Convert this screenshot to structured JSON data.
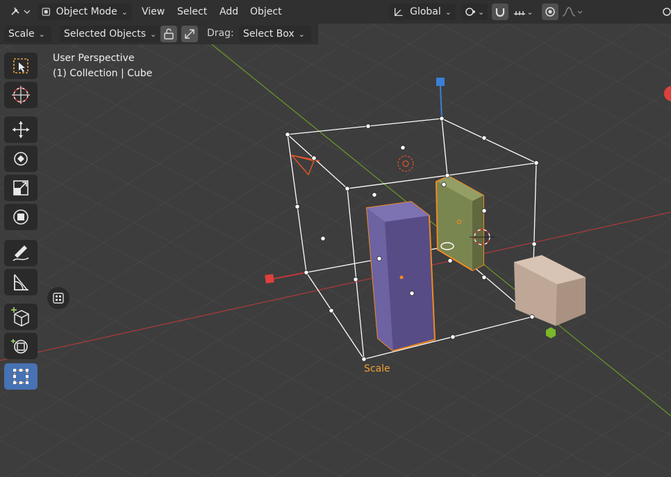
{
  "header": {
    "mode_label": "Object Mode",
    "menus": [
      "View",
      "Select",
      "Add",
      "Object"
    ],
    "orientation_label": "Global"
  },
  "tool_settings": {
    "tool_label": "Scale",
    "affect_label": "Selected Objects",
    "drag_label": "Drag:",
    "drag_value": "Select Box"
  },
  "overlay": {
    "view_name": "User Perspective",
    "collection_info": "(1) Collection | Cube"
  },
  "operator_label": "Scale",
  "toolbar": {
    "tools": [
      {
        "name": "select-box",
        "icon": "select-box-icon",
        "active": false
      },
      {
        "name": "cursor",
        "icon": "cursor-icon",
        "active": false
      },
      {
        "name": "move",
        "icon": "move-icon",
        "active": false
      },
      {
        "name": "rotate",
        "icon": "rotate-icon",
        "active": false
      },
      {
        "name": "scale",
        "icon": "scale-icon",
        "active": false
      },
      {
        "name": "transform",
        "icon": "transform-icon",
        "active": false
      },
      {
        "name": "annotate",
        "icon": "annotate-icon",
        "active": false
      },
      {
        "name": "measure",
        "icon": "measure-icon",
        "active": false
      },
      {
        "name": "add-cube",
        "icon": "add-cube-icon",
        "active": false
      },
      {
        "name": "spin",
        "icon": "spin-icon",
        "active": false
      },
      {
        "name": "scale-cage",
        "icon": "scale-cage-icon",
        "active": true
      }
    ]
  },
  "colors": {
    "header_bg": "#303030",
    "viewport_bg": "#3d3d3d",
    "active_tool": "#4772b3",
    "selection_orange": "#f08a24",
    "axis_x": "#c0373a",
    "axis_y": "#6a9a2a",
    "axis_z": "#3a7fd8",
    "purple_box": "#5a4f8a",
    "olive_box": "#7a8650",
    "tan_box": "#c8b0a0"
  }
}
